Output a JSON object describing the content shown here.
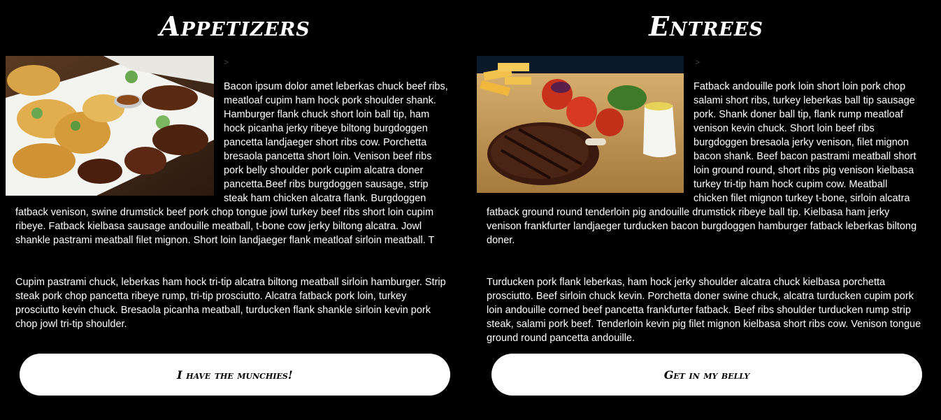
{
  "appetizers": {
    "title": "Appetizers",
    "caret": ">",
    "paragraph1": "Bacon ipsum dolor amet leberkas chuck beef ribs, meatloaf cupim ham hock pork shoulder shank. Hamburger flank chuck short loin ball tip, ham hock picanha jerky ribeye biltong burgdoggen pancetta landjaeger short ribs cow. Porchetta bresaola pancetta short loin. Venison beef ribs pork belly shoulder pork cupim alcatra doner pancetta.Beef ribs burgdoggen sausage, strip steak ham chicken alcatra flank. Burgdoggen fatback venison, swine drumstick beef pork chop tongue jowl turkey beef ribs short loin cupim ribeye. Fatback kielbasa sausage andouille meatball, t-bone cow jerky biltong alcatra. Jowl shankle pastrami meatball filet mignon. Short loin landjaeger flank meatloaf sirloin meatball. T",
    "paragraph2": "Cupim pastrami chuck, leberkas ham hock tri-tip alcatra biltong meatball sirloin hamburger. Strip steak pork chop pancetta ribeye rump, tri-tip prosciutto. Alcatra fatback pork loin, turkey prosciutto kevin chuck. Bresaola picanha meatball, turducken flank shankle sirloin kevin pork chop jowl tri-tip shoulder.",
    "button": "I have the munchies!"
  },
  "entrees": {
    "title": "Entrees",
    "caret": ">",
    "paragraph1": "Fatback andouille pork loin short loin pork chop salami short ribs, turkey leberkas ball tip sausage pork. Shank doner ball tip, flank rump meatloaf venison kevin chuck. Short loin beef ribs burgdoggen bresaola jerky venison, filet mignon bacon shank. Beef bacon pastrami meatball short loin ground round, short ribs pig venison kielbasa turkey tri-tip ham hock cupim cow. Meatball chicken filet mignon turkey t-bone, sirloin alcatra fatback ground round tenderloin pig andouille drumstick ribeye ball tip. Kielbasa ham jerky venison frankfurter landjaeger turducken bacon burgdoggen hamburger fatback leberkas biltong doner.",
    "paragraph2": "Turducken pork flank leberkas, ham hock jerky shoulder alcatra chuck kielbasa porchetta prosciutto. Beef sirloin chuck kevin. Porchetta doner swine chuck, alcatra turducken cupim pork loin andouille corned beef pancetta frankfurter fatback. Beef ribs shoulder turducken rump strip steak, salami pork beef. Tenderloin kevin pig filet mignon kielbasa short ribs cow. Venison tongue ground round pancetta andouille.",
    "button": "Get in my belly"
  }
}
